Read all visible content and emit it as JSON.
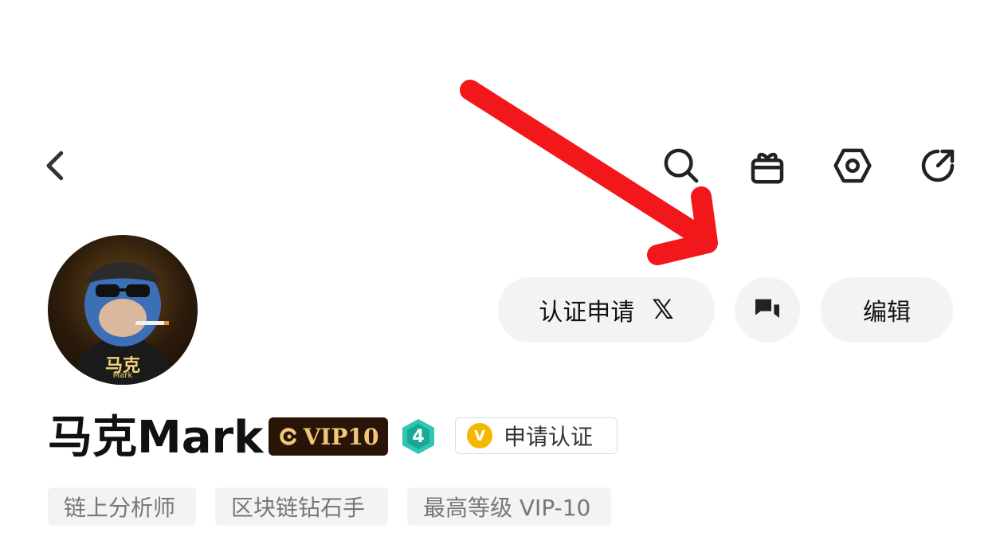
{
  "header": {
    "back_icon": "chevron-left-icon",
    "actions": [
      "search-icon",
      "gift-icon",
      "settings-hex-icon",
      "share-icon"
    ]
  },
  "avatar": {
    "badge_text": "马克",
    "badge_sub": "Mark"
  },
  "actions": {
    "verify_label": "认证申请",
    "x_label": "𝕏",
    "message_icon": "chat-bubbles-icon",
    "edit_label": "编辑"
  },
  "profile": {
    "name": "马克Mark",
    "vip_label": "VIP10",
    "level": "4",
    "apply_verify_label": "申请认证",
    "apply_badge": "V"
  },
  "tags": [
    "链上分析师",
    "区块链钻石手",
    "最高等级 VIP-10"
  ],
  "colors": {
    "annotation_arrow": "#f2171b",
    "vip_bg": "#2a1408",
    "vip_text": "#f1c878",
    "level_badge": "#2fc7b2",
    "verify_badge": "#f5b800"
  }
}
